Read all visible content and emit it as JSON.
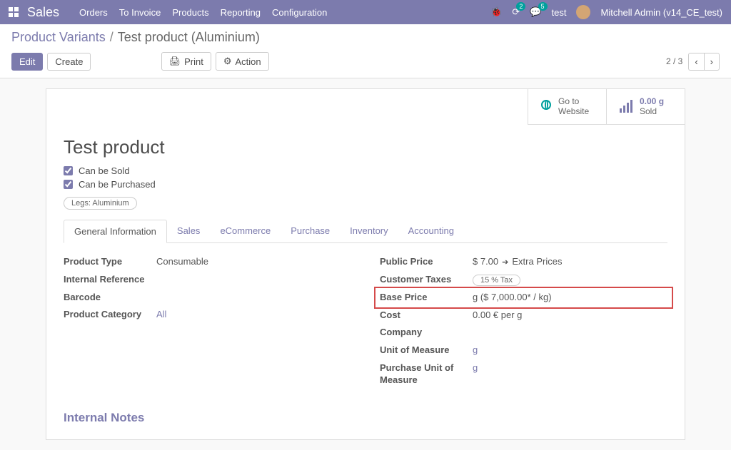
{
  "navbar": {
    "brand": "Sales",
    "menu": [
      "Orders",
      "To Invoice",
      "Products",
      "Reporting",
      "Configuration"
    ],
    "debug_badge": "2",
    "chat_badge": "5",
    "db": "test",
    "user": "Mitchell Admin (v14_CE_test)"
  },
  "breadcrumb": {
    "root": "Product Variants",
    "current": "Test product (Aluminium)"
  },
  "buttons": {
    "edit": "Edit",
    "create": "Create",
    "print": "Print",
    "action": "Action"
  },
  "pager": {
    "text": "2 / 3"
  },
  "stat": {
    "website_line1": "Go to",
    "website_line2": "Website",
    "sold_val": "0.00 g",
    "sold_label": "Sold"
  },
  "form": {
    "title": "Test product",
    "can_sold": "Can be Sold",
    "can_purchased": "Can be Purchased",
    "variant_tag": "Legs: Aluminium",
    "tabs": [
      "General Information",
      "Sales",
      "eCommerce",
      "Purchase",
      "Inventory",
      "Accounting"
    ],
    "left": {
      "product_type_lbl": "Product Type",
      "product_type_val": "Consumable",
      "internal_ref_lbl": "Internal Reference",
      "barcode_lbl": "Barcode",
      "category_lbl": "Product Category",
      "category_val": "All"
    },
    "right": {
      "public_price_lbl": "Public Price",
      "public_price_val": "$ 7.00",
      "extra_prices": "Extra Prices",
      "cust_tax_lbl": "Customer Taxes",
      "cust_tax_val": "15 % Tax",
      "base_price_lbl": "Base Price",
      "base_price_val": "g ($ 7,000.00* / kg)",
      "cost_lbl": "Cost",
      "cost_val": "0.00 € per g",
      "company_lbl": "Company",
      "uom_lbl": "Unit of Measure",
      "uom_val": "g",
      "puom_lbl": "Purchase Unit of Measure",
      "puom_val": "g"
    },
    "section": "Internal Notes"
  }
}
